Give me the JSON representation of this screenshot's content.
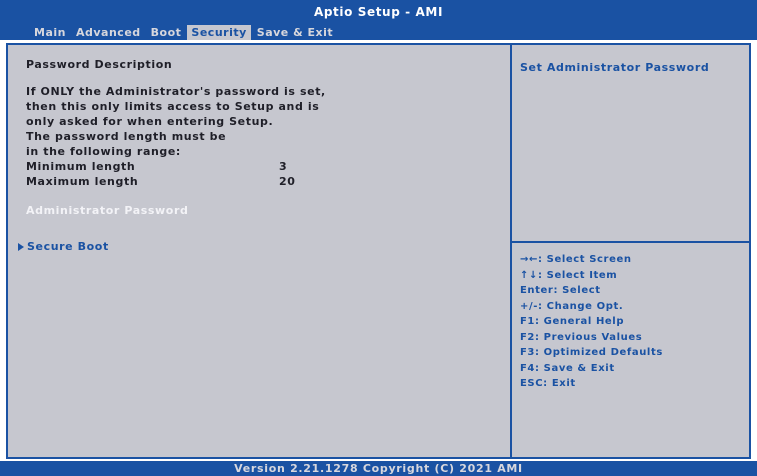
{
  "header": {
    "title": "Aptio Setup - AMI",
    "tabs": [
      {
        "label": "Main",
        "active": false
      },
      {
        "label": "Advanced",
        "active": false
      },
      {
        "label": "Boot",
        "active": false
      },
      {
        "label": "Security",
        "active": true
      },
      {
        "label": "Save & Exit",
        "active": false
      }
    ]
  },
  "main": {
    "section_title": "Password Description",
    "description_lines": [
      "If ONLY the Administrator's password is set,",
      "then this only limits access to Setup and is",
      "only asked for when entering Setup.",
      "The password length must be",
      "in the following range:"
    ],
    "min_length_label": "Minimum length",
    "min_length_value": "3",
    "max_length_label": "Maximum length",
    "max_length_value": "20",
    "admin_password_label": "Administrator Password",
    "secure_boot_label": "Secure Boot"
  },
  "help": {
    "text": "Set Administrator Password"
  },
  "keys": [
    "→←: Select Screen",
    "↑↓: Select Item",
    "Enter: Select",
    "+/-: Change Opt.",
    "F1: General Help",
    "F2: Previous Values",
    "F3: Optimized Defaults",
    "F4: Save & Exit",
    "ESC: Exit"
  ],
  "footer": {
    "version": "Version 2.21.1278 Copyright (C) 2021 AMI"
  },
  "colors": {
    "bios_blue": "#1a52a3",
    "panel_gray": "#c6c7cf",
    "text_dark": "#1f1f28",
    "highlight_white": "#f3f3f7"
  }
}
